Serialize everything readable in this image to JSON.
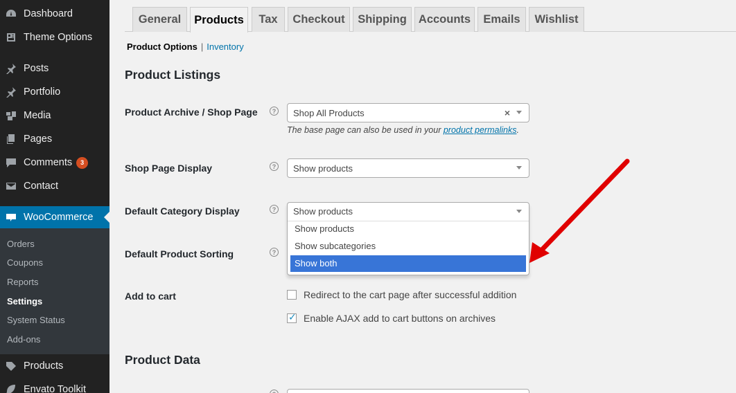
{
  "sidebar": {
    "items": [
      {
        "label": "Dashboard",
        "icon": "dashboard-icon"
      },
      {
        "label": "Theme Options",
        "icon": "theme-options-icon"
      },
      {
        "label": "Posts",
        "icon": "pin-icon"
      },
      {
        "label": "Portfolio",
        "icon": "pin-icon"
      },
      {
        "label": "Media",
        "icon": "media-icon"
      },
      {
        "label": "Pages",
        "icon": "pages-icon"
      },
      {
        "label": "Comments",
        "icon": "comment-icon",
        "badge": "3"
      },
      {
        "label": "Contact",
        "icon": "envelope-icon"
      },
      {
        "label": "WooCommerce",
        "icon": "woocommerce-icon"
      },
      {
        "label": "Products",
        "icon": "products-icon"
      },
      {
        "label": "Envato Toolkit",
        "icon": "leaf-icon"
      }
    ],
    "submenu": [
      "Orders",
      "Coupons",
      "Reports",
      "Settings",
      "System Status",
      "Add-ons"
    ],
    "current_submenu": "Settings"
  },
  "tabs": [
    "General",
    "Products",
    "Tax",
    "Checkout",
    "Shipping",
    "Accounts",
    "Emails",
    "Wishlist"
  ],
  "active_tab": "Products",
  "subnav": {
    "current": "Product Options",
    "separator": "|",
    "link": "Inventory"
  },
  "sections": {
    "listings_title": "Product Listings",
    "data_title": "Product Data"
  },
  "fields": {
    "shop_page": {
      "label": "Product Archive / Shop Page",
      "value": "Shop All Products",
      "clear": "×",
      "desc_prefix": "The base page can also be used in your ",
      "desc_link": "product permalinks",
      "desc_suffix": "."
    },
    "shop_display": {
      "label": "Shop Page Display",
      "value": "Show products"
    },
    "category_display": {
      "label": "Default Category Display",
      "value": "Show products",
      "options": [
        "Show products",
        "Show subcategories",
        "Show both"
      ],
      "highlighted": "Show both"
    },
    "sorting": {
      "label": "Default Product Sorting"
    },
    "add_to_cart": {
      "label": "Add to cart",
      "redirect": {
        "label": "Redirect to the cart page after successful addition",
        "checked": false
      },
      "ajax": {
        "label": "Enable AJAX add to cart buttons on archives",
        "checked": true
      }
    }
  },
  "help_glyph": "?",
  "colors": {
    "sidebar": "#222222",
    "accent": "#0073aa",
    "highlight": "#3875d7",
    "annotation_arrow": "#e00000"
  }
}
